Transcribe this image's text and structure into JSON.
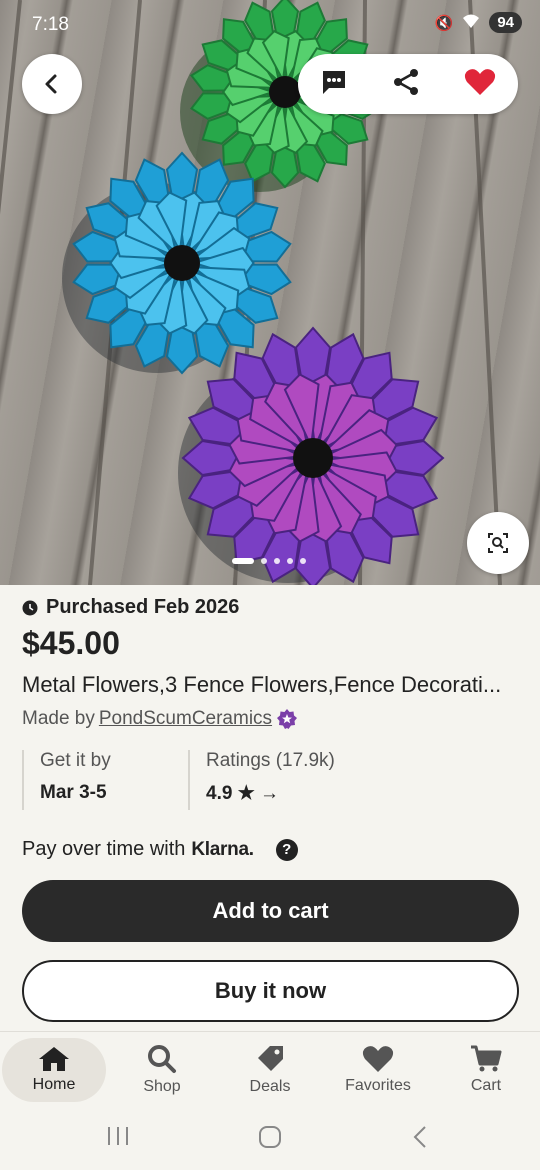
{
  "status_bar": {
    "time": "7:18",
    "battery": "94"
  },
  "image_carousel": {
    "total_slides": 5,
    "active_slide": 1
  },
  "listing": {
    "purchased": "Purchased Feb 2026",
    "price": "$45.00",
    "title": "Metal Flowers,3 Fence Flowers,Fence Decorati...",
    "made_by_prefix": "Made by",
    "shop_name": "PondScumCeramics"
  },
  "delivery": {
    "label": "Get it by",
    "value": "Mar 3-5"
  },
  "ratings": {
    "label": "Ratings (17.9k)",
    "value": "4.9",
    "arrow": "→"
  },
  "klarna": {
    "prefix": "Pay over time with",
    "brand": "Klarna.",
    "help": "?"
  },
  "buttons": {
    "add_to_cart": "Add to cart",
    "buy_now": "Buy it now"
  },
  "bottom_nav": {
    "items": [
      {
        "label": "Home",
        "icon": "home-icon"
      },
      {
        "label": "Shop",
        "icon": "search-icon"
      },
      {
        "label": "Deals",
        "icon": "tag-icon"
      },
      {
        "label": "Favorites",
        "icon": "heart-icon"
      },
      {
        "label": "Cart",
        "icon": "cart-icon"
      }
    ],
    "active_index": 0
  },
  "colors": {
    "favorite": "#e0263a",
    "star_badge": "#7b3fa8",
    "button_dark": "#2a2a2a"
  }
}
